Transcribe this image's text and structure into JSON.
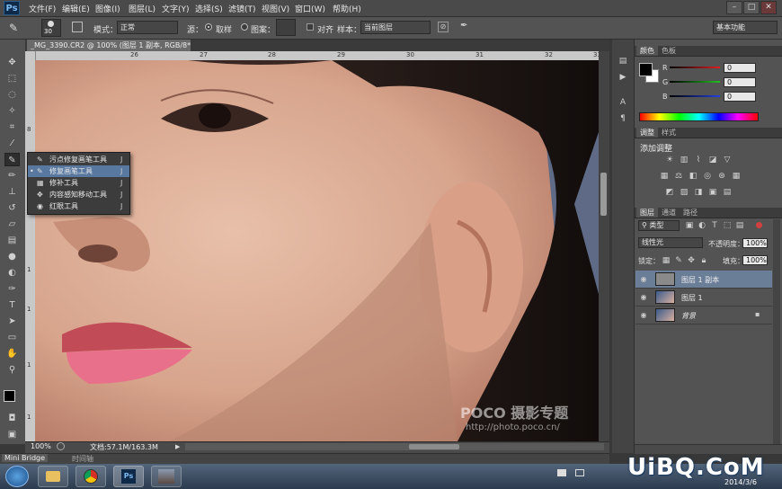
{
  "app": {
    "logo": "Ps"
  },
  "menu": [
    "文件(F)",
    "编辑(E)",
    "图像(I)",
    "图层(L)",
    "文字(Y)",
    "选择(S)",
    "滤镜(T)",
    "视图(V)",
    "窗口(W)",
    "帮助(H)"
  ],
  "window_controls": {
    "minimize": "–",
    "maximize": "□",
    "close": "✕"
  },
  "options": {
    "brush_size": "30",
    "mode_label": "模式：",
    "mode_value": "正常",
    "source_label": "源：",
    "sampled_label": "取样",
    "pattern_label": "图案：",
    "aligned_label": "对齐",
    "sample_label": "样本：",
    "sample_value": "当前图层",
    "workspace": "基本功能"
  },
  "document_tab": "_MG_3390.CR2 @ 100% (图层 1 副本, RGB/8*) *",
  "ruler": {
    "top": [
      "26",
      "27",
      "28",
      "29",
      "30",
      "31",
      "32",
      "33"
    ],
    "left": [
      "8",
      "9",
      "1",
      "1",
      "1",
      "1"
    ]
  },
  "flyout": [
    {
      "label": "污点修复画笔工具",
      "key": "J",
      "icon": "spot-healing-brush-icon",
      "selected": false
    },
    {
      "label": "修复画笔工具",
      "key": "J",
      "icon": "healing-brush-icon",
      "selected": true
    },
    {
      "label": "修补工具",
      "key": "J",
      "icon": "patch-icon",
      "selected": false
    },
    {
      "label": "内容感知移动工具",
      "key": "J",
      "icon": "content-aware-move-icon",
      "selected": false
    },
    {
      "label": "红眼工具",
      "key": "J",
      "icon": "red-eye-icon",
      "selected": false
    }
  ],
  "status": {
    "zoom": "100%",
    "doc_info": "文档:57.1M/163.3M"
  },
  "bottom_tabs": [
    "Mini Bridge",
    "时间轴"
  ],
  "color_panel": {
    "tabs": [
      "颜色",
      "色板"
    ],
    "channels": [
      {
        "label": "R",
        "value": "0",
        "color": "#e02020"
      },
      {
        "label": "G",
        "value": "0",
        "color": "#20c020"
      },
      {
        "label": "B",
        "value": "0",
        "color": "#2040e0"
      }
    ]
  },
  "adjustments_panel": {
    "tabs": [
      "调整",
      "样式"
    ],
    "title": "添加调整"
  },
  "layers_panel": {
    "tabs": [
      "图层",
      "通道",
      "路径"
    ],
    "filter_type": "类型",
    "blend_mode": "线性光",
    "opacity_label": "不透明度：",
    "opacity_value": "100%",
    "lock_label": "锁定：",
    "fill_label": "填充：",
    "fill_value": "100%",
    "layers": [
      {
        "name": "图层 1 副本",
        "selected": true
      },
      {
        "name": "图层 1",
        "selected": false
      },
      {
        "name": "背景",
        "selected": false
      }
    ]
  },
  "watermark": {
    "brand": "POCO 摄影专题",
    "url": "http://photo.poco.cn/"
  },
  "corner_watermark": "UiBQ.CoM",
  "taskbar": {
    "date": "2014/3/6"
  }
}
